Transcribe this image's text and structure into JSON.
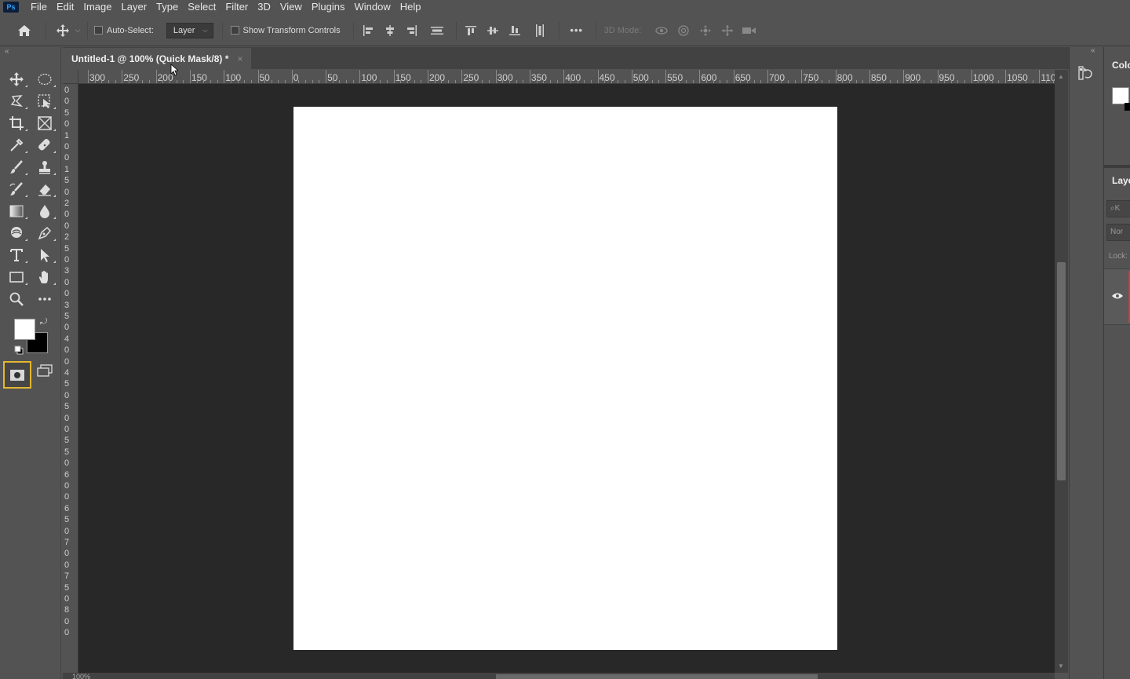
{
  "app": {
    "logo": "Ps"
  },
  "menu": [
    "File",
    "Edit",
    "Image",
    "Layer",
    "Type",
    "Select",
    "Filter",
    "3D",
    "View",
    "Plugins",
    "Window",
    "Help"
  ],
  "options_bar": {
    "auto_select_label": "Auto-Select:",
    "auto_select_target": "Layer",
    "show_transform_label": "Show Transform Controls",
    "more_label": "•••",
    "mode_3d_label": "3D Mode:"
  },
  "document_tab": {
    "title": "Untitled-1 @ 100% (Quick Mask/8) *",
    "close": "×"
  },
  "ruler_h": [
    "300",
    "250",
    "200",
    "150",
    "100",
    "50",
    "0",
    "50",
    "100",
    "150",
    "200",
    "250",
    "300",
    "350",
    "400",
    "450",
    "500",
    "550",
    "600",
    "650",
    "700",
    "750",
    "800",
    "850",
    "900",
    "950",
    "1000",
    "1050",
    "110"
  ],
  "ruler_v": [
    "0",
    "0",
    "5",
    "0",
    "1",
    "0",
    "0",
    "1",
    "5",
    "0",
    "2",
    "0",
    "0",
    "2",
    "5",
    "0",
    "3",
    "0",
    "0",
    "3",
    "5",
    "0",
    "4",
    "0",
    "0",
    "4",
    "5",
    "0",
    "5",
    "0",
    "0",
    "5",
    "5",
    "0",
    "6",
    "0",
    "0",
    "6",
    "5",
    "0",
    "7",
    "0",
    "0",
    "7",
    "5",
    "0",
    "8",
    "0",
    "0"
  ],
  "colors": {
    "foreground": "#ffffff",
    "background": "#000000",
    "quick_mask_highlight": "#e3b72f",
    "canvas_bg": "#282828",
    "ui_bg": "#535353"
  },
  "panels": {
    "color_title": "Colo",
    "layers_title": "Laye",
    "layers_search": "K",
    "layers_blend": "Nor",
    "layers_lock": "Lock:"
  },
  "statusbar": {
    "zoom": "100%"
  }
}
